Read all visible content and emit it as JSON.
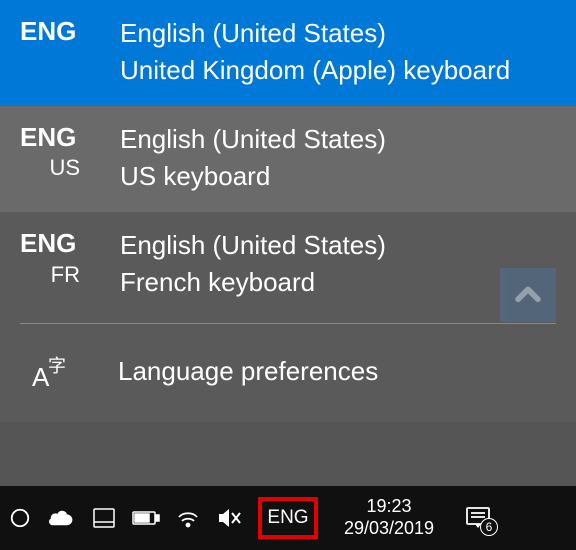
{
  "languages": [
    {
      "code": "ENG",
      "sub": "",
      "name": "English (United States)",
      "keyboard": "United Kingdom (Apple) keyboard",
      "selected": true,
      "hover": false
    },
    {
      "code": "ENG",
      "sub": "US",
      "name": "English (United States)",
      "keyboard": "US keyboard",
      "selected": false,
      "hover": true
    },
    {
      "code": "ENG",
      "sub": "FR",
      "name": "English (United States)",
      "keyboard": "French keyboard",
      "selected": false,
      "hover": false
    }
  ],
  "prefs_label": "Language preferences",
  "tray": {
    "lang_indicator": "ENG",
    "time": "19:23",
    "date": "29/03/2019",
    "badge": "6"
  },
  "colors": {
    "accent": "#0078d7",
    "highlight_border": "#e30000"
  }
}
